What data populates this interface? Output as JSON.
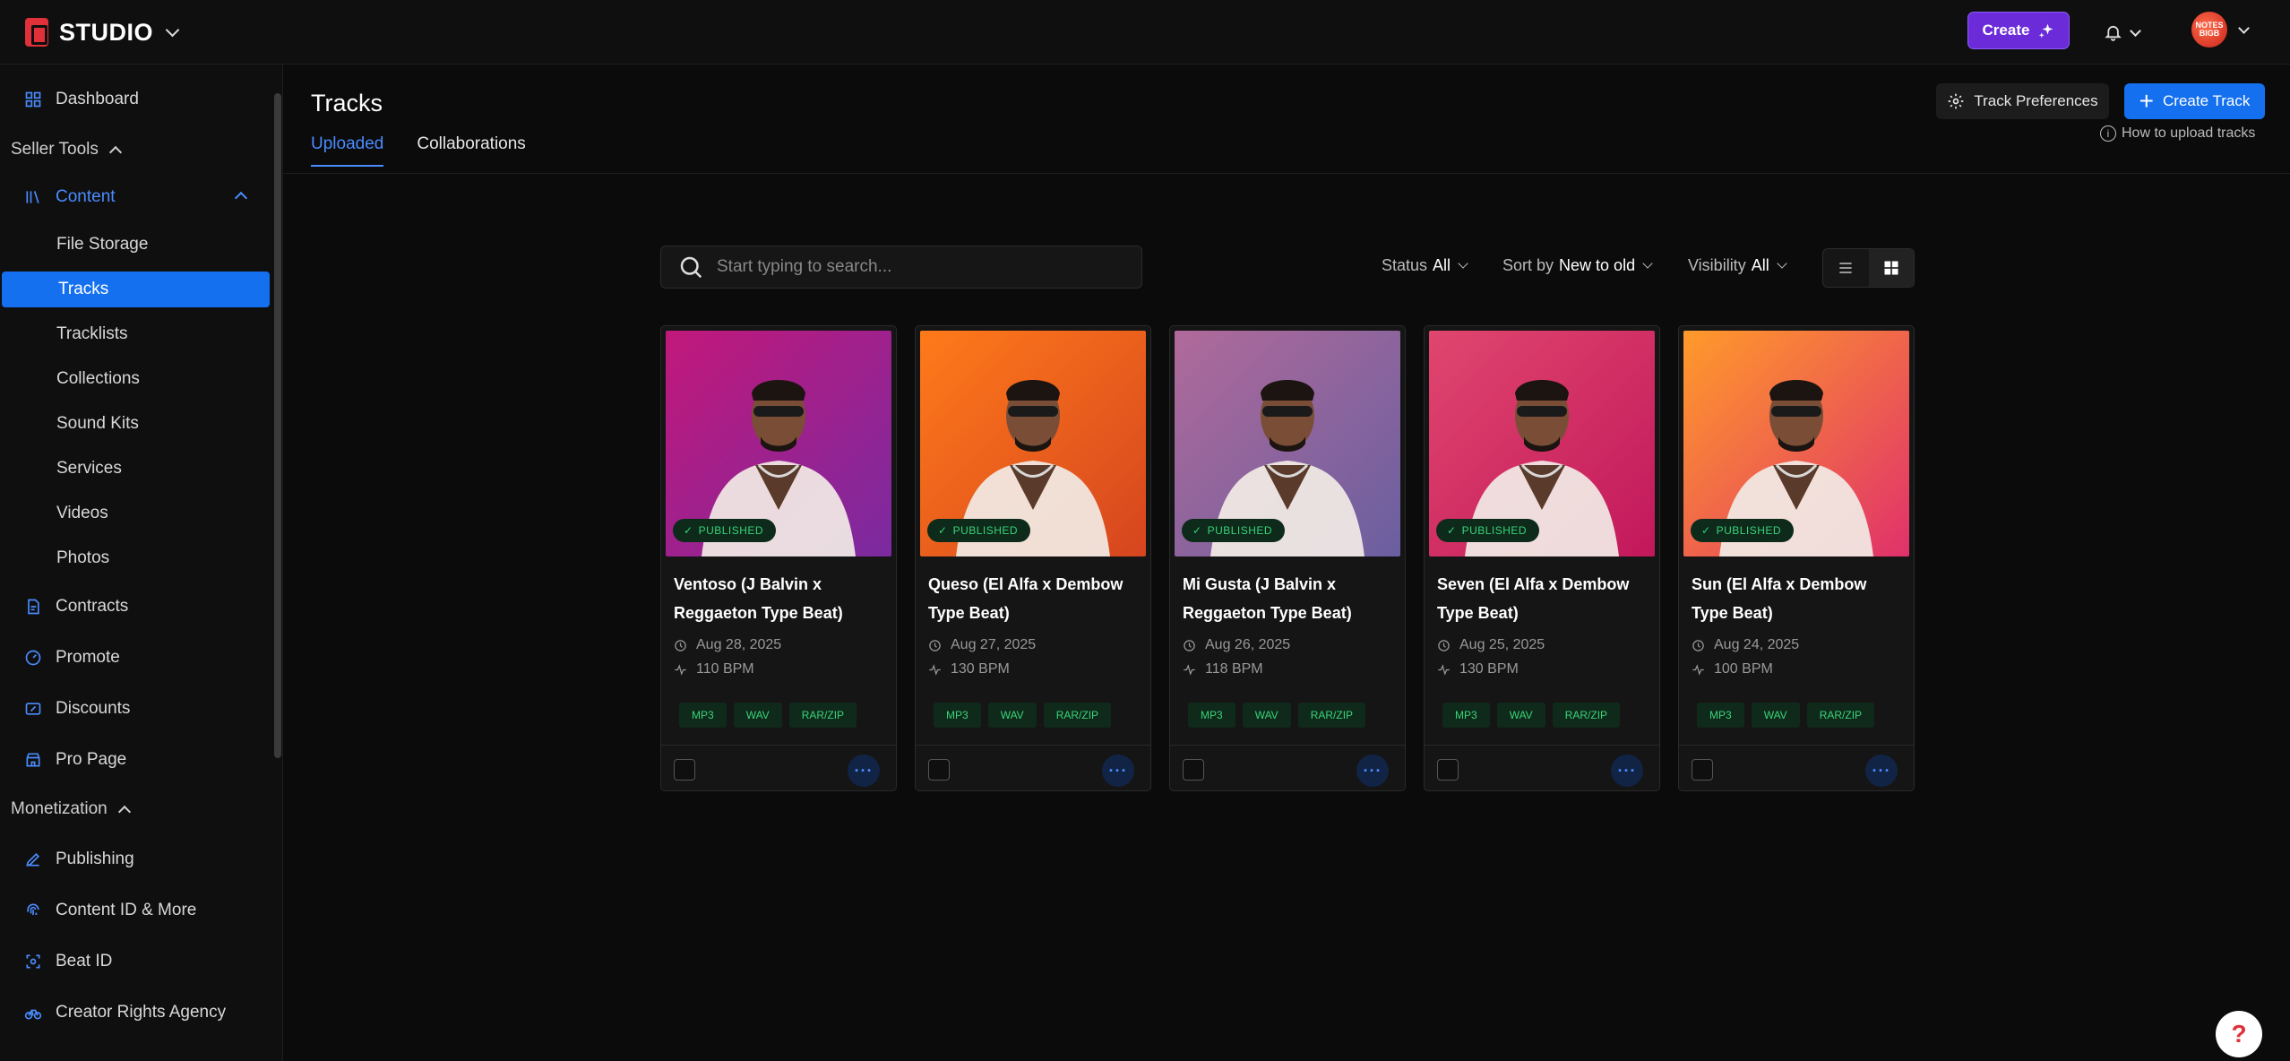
{
  "brand": {
    "name": "STUDIO"
  },
  "topbar": {
    "create_label": "Create",
    "avatar_text": "NOTES BIGB"
  },
  "sidebar": {
    "dashboard": "Dashboard",
    "seller_tools": "Seller Tools",
    "content": "Content",
    "content_items": [
      "File Storage",
      "Tracks",
      "Tracklists",
      "Collections",
      "Sound Kits",
      "Services",
      "Videos",
      "Photos"
    ],
    "active_item": "Tracks",
    "contracts": "Contracts",
    "promote": "Promote",
    "discounts": "Discounts",
    "pro_page": "Pro Page",
    "monetization": "Monetization",
    "publishing": "Publishing",
    "content_id": "Content ID & More",
    "beat_id": "Beat ID",
    "creator_rights": "Creator Rights Agency"
  },
  "page": {
    "title": "Tracks",
    "tabs": [
      "Uploaded",
      "Collaborations"
    ],
    "active_tab": "Uploaded",
    "track_preferences": "Track Preferences",
    "create_track": "Create Track",
    "how_to": "How to upload tracks"
  },
  "filters": {
    "search_placeholder": "Start typing to search...",
    "status_label": "Status",
    "status_value": "All",
    "sort_label": "Sort by",
    "sort_value": "New to old",
    "visibility_label": "Visibility",
    "visibility_value": "All"
  },
  "tracks": [
    {
      "title": "Ventoso (J Balvin x Reggaeton Type Beat)",
      "date": "Aug 28, 2025",
      "bpm": "110 BPM",
      "status": "PUBLISHED",
      "formats": [
        "MP3",
        "WAV",
        "RAR/ZIP"
      ],
      "bg": [
        "#c2187a",
        "#7a2aa0"
      ]
    },
    {
      "title": "Queso (El Alfa x Dembow Type Beat)",
      "date": "Aug 27, 2025",
      "bpm": "130 BPM",
      "status": "PUBLISHED",
      "formats": [
        "MP3",
        "WAV",
        "RAR/ZIP"
      ],
      "bg": [
        "#ff7a1a",
        "#d6451f"
      ]
    },
    {
      "title": "Mi Gusta (J Balvin x Reggaeton Type Beat)",
      "date": "Aug 26, 2025",
      "bpm": "118 BPM",
      "status": "PUBLISHED",
      "formats": [
        "MP3",
        "WAV",
        "RAR/ZIP"
      ],
      "bg": [
        "#b06a9a",
        "#6a5fa0"
      ]
    },
    {
      "title": "Seven (El Alfa x Dembow Type Beat)",
      "date": "Aug 25, 2025",
      "bpm": "130 BPM",
      "status": "PUBLISHED",
      "formats": [
        "MP3",
        "WAV",
        "RAR/ZIP"
      ],
      "bg": [
        "#e0466e",
        "#c2185b"
      ]
    },
    {
      "title": "Sun (El Alfa x Dembow Type Beat)",
      "date": "Aug 24, 2025",
      "bpm": "100 BPM",
      "status": "PUBLISHED",
      "formats": [
        "MP3",
        "WAV",
        "RAR/ZIP"
      ],
      "bg": [
        "#ff9a2a",
        "#e0316b"
      ]
    }
  ],
  "colors": {
    "accent": "#1570ef",
    "create": "#6c2bd9",
    "published": "#39d37a"
  }
}
